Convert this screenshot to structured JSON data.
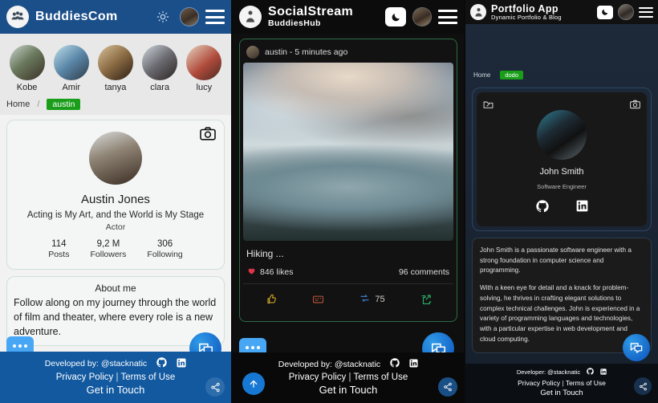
{
  "panel1": {
    "header": {
      "brand": "BuddiesCom",
      "mode_icon": "sun-icon",
      "menu_icon": "hamburger-icon"
    },
    "stories": [
      {
        "name": "Kobe"
      },
      {
        "name": "Amir"
      },
      {
        "name": "tanya"
      },
      {
        "name": "clara"
      },
      {
        "name": "lucy"
      }
    ],
    "breadcrumb": {
      "home": "Home",
      "separator": "/",
      "current": "austin"
    },
    "profile": {
      "camera_icon": "camera-icon",
      "name": "Austin Jones",
      "tagline": "Acting is My Art, and the World is My Stage",
      "role": "Actor",
      "stats": [
        {
          "value": "114",
          "label": "Posts"
        },
        {
          "value": "9,2 M",
          "label": "Followers"
        },
        {
          "value": "306",
          "label": "Following"
        }
      ]
    },
    "about": {
      "title": "About me",
      "body": "Follow along on my journey through the world of film and theater, where every role is a new adventure."
    },
    "footer": {
      "developed_by": "Developed by: @stacknatic",
      "github_icon": "github-icon",
      "linkedin_icon": "linkedin-icon",
      "privacy": "Privacy Policy",
      "sep": "|",
      "terms": "Terms of Use",
      "contact": "Get in Touch",
      "share_icon": "share-icon"
    },
    "chat_fab": "chat-icon",
    "chat_bubble": "typing-bubble-icon",
    "accent": "#1b4f8a",
    "footer_color": "#1259a0",
    "badge_color": "#1a9e1a"
  },
  "panel2": {
    "header": {
      "brand": "SocialStream",
      "subtitle": "BuddiesHub",
      "mode_icon": "moon-icon",
      "menu_icon": "hamburger-icon"
    },
    "post": {
      "author": "austin",
      "meta": "austin  -  5 minutes ago",
      "time": "5 minutes ago",
      "caption": "Hiking ...",
      "likes": "846 likes",
      "comments": "96 comments",
      "like_icon": "thumbs-up-icon",
      "comment_icon": "comment-icon",
      "repost_icon": "repost-icon",
      "repost_count": "75",
      "share_icon": "share-arrow-icon",
      "heart_icon": "heart-icon"
    },
    "footer": {
      "developed_by": "Developed by: @stacknatic",
      "github_icon": "github-icon",
      "linkedin_icon": "linkedin-icon",
      "privacy": "Privacy Policy",
      "sep": "|",
      "terms": "Terms of Use",
      "contact": "Get in Touch",
      "scroll_top_icon": "arrow-up-icon",
      "share_icon": "share-icon"
    },
    "chat_fab": "chat-icon",
    "chat_bubble": "typing-bubble-icon"
  },
  "panel3": {
    "header": {
      "brand": "Portfolio App",
      "subtitle": "Dynamic Portfolio & Blog",
      "mode_icon": "moon-icon",
      "menu_icon": "hamburger-icon"
    },
    "breadcrumb": {
      "home": "Home",
      "current": "dodo"
    },
    "card": {
      "edit_icon": "edit-image-icon",
      "camera_icon": "camera-icon",
      "name": "John Smith",
      "role": "Software Engineer",
      "github_icon": "github-icon",
      "linkedin_icon": "linkedin-icon"
    },
    "bio": {
      "p1": "John Smith is a passionate software engineer with a strong foundation in computer science and programming.",
      "p2": "With a keen eye for detail and a knack for problem-solving, he thrives in crafting elegant solutions to complex technical challenges. John is experienced in a variety of programming languages and technologies, with a particular expertise in web development and cloud computing."
    },
    "footer": {
      "developed_by": "Developer: @stacknatic",
      "github_icon": "github-icon",
      "linkedin_icon": "linkedin-icon",
      "privacy": "Privacy Policy",
      "sep": "|",
      "terms": "Terms of Use",
      "contact": "Get in Touch",
      "share_icon": "share-icon"
    },
    "chat_fab": "chat-icon",
    "badge_color": "#1a9e1a"
  }
}
